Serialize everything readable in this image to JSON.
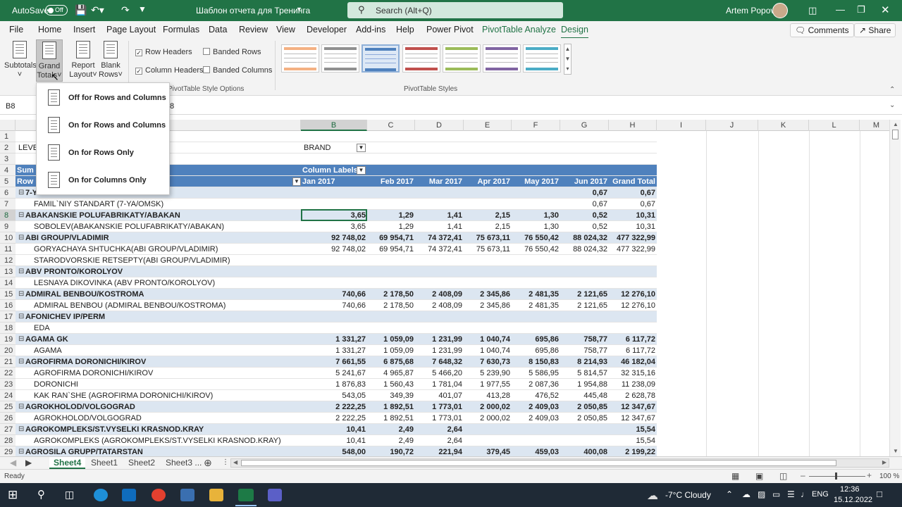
{
  "titlebar": {
    "autosave_label": "AutoSave",
    "autosave_state": "Off",
    "filename": "Шаблон отчета для Тренинга",
    "search_placeholder": "Search (Alt+Q)",
    "user": "Artem Popov"
  },
  "menu": {
    "tabs": [
      "File",
      "Home",
      "Insert",
      "Page Layout",
      "Formulas",
      "Data",
      "Review",
      "View",
      "Developer",
      "Add-ins",
      "Help",
      "Power Pivot",
      "PivotTable Analyze",
      "Design"
    ],
    "comments": "Comments",
    "share": "Share"
  },
  "ribbon": {
    "subtotals": "Subtotals",
    "grand_totals_1": "Grand",
    "grand_totals_2": "Totals",
    "report_layout_1": "Report",
    "report_layout_2": "Layout",
    "blank_rows_1": "Blank",
    "blank_rows_2": "Rows",
    "row_headers": "Row Headers",
    "column_headers": "Column Headers",
    "banded_rows": "Banded Rows",
    "banded_columns": "Banded Columns",
    "options_group": "PivotTable Style Options",
    "styles_group": "PivotTable Styles"
  },
  "grand_totals_menu": [
    {
      "label": "Off for Rows and Columns"
    },
    {
      "label": "On for Rows and Columns"
    },
    {
      "label": "On for Rows Only"
    },
    {
      "label": "On for Columns Only"
    }
  ],
  "formula_bar": {
    "name_box": "B8",
    "formula": "8"
  },
  "columns": [
    "",
    "B",
    "C",
    "D",
    "E",
    "F",
    "G",
    "H",
    "I",
    "J",
    "K",
    "L",
    "M"
  ],
  "pivot": {
    "level_label": "LEVEL",
    "brand_label": "BRAND",
    "sum_label": "Sum o",
    "row_label": "Row L",
    "column_labels": "Column Labels",
    "months": [
      "Jan 2017",
      "Feb 2017",
      "Mar 2017",
      "Apr 2017",
      "May 2017",
      "Jun 2017",
      "Grand Total"
    ],
    "rows": [
      {
        "n": "6",
        "label": "7-YA/OMSK",
        "bold": true,
        "v": [
          "",
          "",
          "",
          "",
          "",
          "0,67",
          "0,67"
        ]
      },
      {
        "n": "7",
        "label": "FAMIL`NIY STANDART (7-YA/OMSK)",
        "bold": false,
        "v": [
          "",
          "",
          "",
          "",
          "",
          "0,67",
          "0,67"
        ]
      },
      {
        "n": "8",
        "label": "ABAKANSKIE POLUFABRIKATY/ABAKAN",
        "bold": true,
        "v": [
          "3,65",
          "1,29",
          "1,41",
          "2,15",
          "1,30",
          "0,52",
          "10,31"
        ]
      },
      {
        "n": "9",
        "label": "SOBOLEV(ABAKANSKIE POLUFABRIKATY/ABAKAN)",
        "bold": false,
        "v": [
          "3,65",
          "1,29",
          "1,41",
          "2,15",
          "1,30",
          "0,52",
          "10,31"
        ]
      },
      {
        "n": "10",
        "label": "ABI GROUP/VLADIMIR",
        "bold": true,
        "v": [
          "92 748,02",
          "69 954,71",
          "74 372,41",
          "75 673,11",
          "76 550,42",
          "88 024,32",
          "477 322,99"
        ]
      },
      {
        "n": "11",
        "label": "GORYACHAYA SHTUCHKA(ABI GROUP/VLADIMIR)",
        "bold": false,
        "v": [
          "92 748,02",
          "69 954,71",
          "74 372,41",
          "75 673,11",
          "76 550,42",
          "88 024,32",
          "477 322,99"
        ]
      },
      {
        "n": "12",
        "label": "STARODVORSKIE RETSEPTY(ABI GROUP/VLADIMIR)",
        "bold": false,
        "v": [
          "",
          "",
          "",
          "",
          "",
          "",
          ""
        ]
      },
      {
        "n": "13",
        "label": "ABV PRONTO/KOROLYOV",
        "bold": true,
        "v": [
          "",
          "",
          "",
          "",
          "",
          "",
          ""
        ]
      },
      {
        "n": "14",
        "label": "LESNAYA DIKOVINKA (ABV PRONTO/KOROLYOV)",
        "bold": false,
        "v": [
          "",
          "",
          "",
          "",
          "",
          "",
          ""
        ]
      },
      {
        "n": "15",
        "label": "ADMIRAL BENBOU/KOSTROMA",
        "bold": true,
        "v": [
          "740,66",
          "2 178,50",
          "2 408,09",
          "2 345,86",
          "2 481,35",
          "2 121,65",
          "12 276,10"
        ]
      },
      {
        "n": "16",
        "label": "ADMIRAL BENBOU (ADMIRAL BENBOU/KOSTROMA)",
        "bold": false,
        "v": [
          "740,66",
          "2 178,50",
          "2 408,09",
          "2 345,86",
          "2 481,35",
          "2 121,65",
          "12 276,10"
        ]
      },
      {
        "n": "17",
        "label": "AFONICHEV IP/PERM",
        "bold": true,
        "v": [
          "",
          "",
          "",
          "",
          "",
          "",
          ""
        ]
      },
      {
        "n": "18",
        "label": "EDA",
        "bold": false,
        "v": [
          "",
          "",
          "",
          "",
          "",
          "",
          ""
        ]
      },
      {
        "n": "19",
        "label": "AGAMA GK",
        "bold": true,
        "v": [
          "1 331,27",
          "1 059,09",
          "1 231,99",
          "1 040,74",
          "695,86",
          "758,77",
          "6 117,72"
        ]
      },
      {
        "n": "20",
        "label": "AGAMA",
        "bold": false,
        "v": [
          "1 331,27",
          "1 059,09",
          "1 231,99",
          "1 040,74",
          "695,86",
          "758,77",
          "6 117,72"
        ]
      },
      {
        "n": "21",
        "label": "AGROFIRMA DORONICHI/KIROV",
        "bold": true,
        "v": [
          "7 661,55",
          "6 875,68",
          "7 648,32",
          "7 630,73",
          "8 150,83",
          "8 214,93",
          "46 182,04"
        ]
      },
      {
        "n": "22",
        "label": "AGROFIRMA DORONICHI/KIROV",
        "bold": false,
        "v": [
          "5 241,67",
          "4 965,87",
          "5 466,20",
          "5 239,90",
          "5 586,95",
          "5 814,57",
          "32 315,16"
        ]
      },
      {
        "n": "23",
        "label": "DORONICHI",
        "bold": false,
        "v": [
          "1 876,83",
          "1 560,43",
          "1 781,04",
          "1 977,55",
          "2 087,36",
          "1 954,88",
          "11 238,09"
        ]
      },
      {
        "n": "24",
        "label": "KAK RAN`SHE (AGROFIRMA DORONICHI/KIROV)",
        "bold": false,
        "v": [
          "543,05",
          "349,39",
          "401,07",
          "413,28",
          "476,52",
          "445,48",
          "2 628,78"
        ]
      },
      {
        "n": "25",
        "label": "AGROKHOLOD/VOLGOGRAD",
        "bold": true,
        "v": [
          "2 222,25",
          "1 892,51",
          "1 773,01",
          "2 000,02",
          "2 409,03",
          "2 050,85",
          "12 347,67"
        ]
      },
      {
        "n": "26",
        "label": "AGROKHOLOD/VOLGOGRAD",
        "bold": false,
        "v": [
          "2 222,25",
          "1 892,51",
          "1 773,01",
          "2 000,02",
          "2 409,03",
          "2 050,85",
          "12 347,67"
        ]
      },
      {
        "n": "27",
        "label": "AGROKOMPLEKS/ST.VYSELKI KRASNOD.KRAY",
        "bold": true,
        "v": [
          "10,41",
          "2,49",
          "2,64",
          "",
          "",
          "",
          "15,54"
        ]
      },
      {
        "n": "28",
        "label": "AGROKOMPLEKS (AGROKOMPLEKS/ST.VYSELKI KRASNOD.KRAY)",
        "bold": false,
        "v": [
          "10,41",
          "2,49",
          "2,64",
          "",
          "",
          "",
          "15,54"
        ]
      },
      {
        "n": "29",
        "label": "AGROSILA GRUPP/TATARSTAN",
        "bold": true,
        "v": [
          "548,00",
          "190,72",
          "221,94",
          "379,45",
          "459,03",
          "400,08",
          "2 199,22"
        ]
      }
    ]
  },
  "sheets": [
    "Sheet4",
    "Sheet1",
    "Sheet2",
    "Sheet3 ..."
  ],
  "status": {
    "ready": "Ready",
    "zoom": "100 %"
  },
  "taskbar": {
    "weather": "-7°C  Cloudy",
    "lang": "ENG",
    "time": "12:36",
    "date": "15.12.2022"
  }
}
